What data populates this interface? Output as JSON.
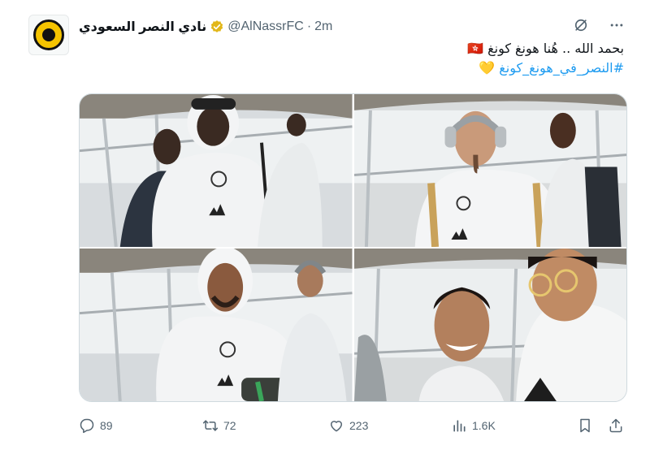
{
  "author": {
    "display_name": "نادي النصر السعودي",
    "handle": "@AlNassrFC",
    "separator": "·",
    "time": "2m"
  },
  "tweet": {
    "line1": "بحمد الله .. هُنا هونغ كونغ 🇭🇰",
    "hashtag": "#النصر_في_هونغ_كونغ",
    "emoji": "💛"
  },
  "media": [
    {
      "name": "photo-1"
    },
    {
      "name": "photo-2"
    },
    {
      "name": "photo-3"
    },
    {
      "name": "photo-4"
    }
  ],
  "actions": {
    "replies": "89",
    "reposts": "72",
    "likes": "223",
    "views": "1.6K"
  },
  "colors": {
    "accent": "#1d9bf0",
    "muted": "#536471",
    "verified_gold": "#e2b719",
    "club_yellow": "#f5c400"
  }
}
